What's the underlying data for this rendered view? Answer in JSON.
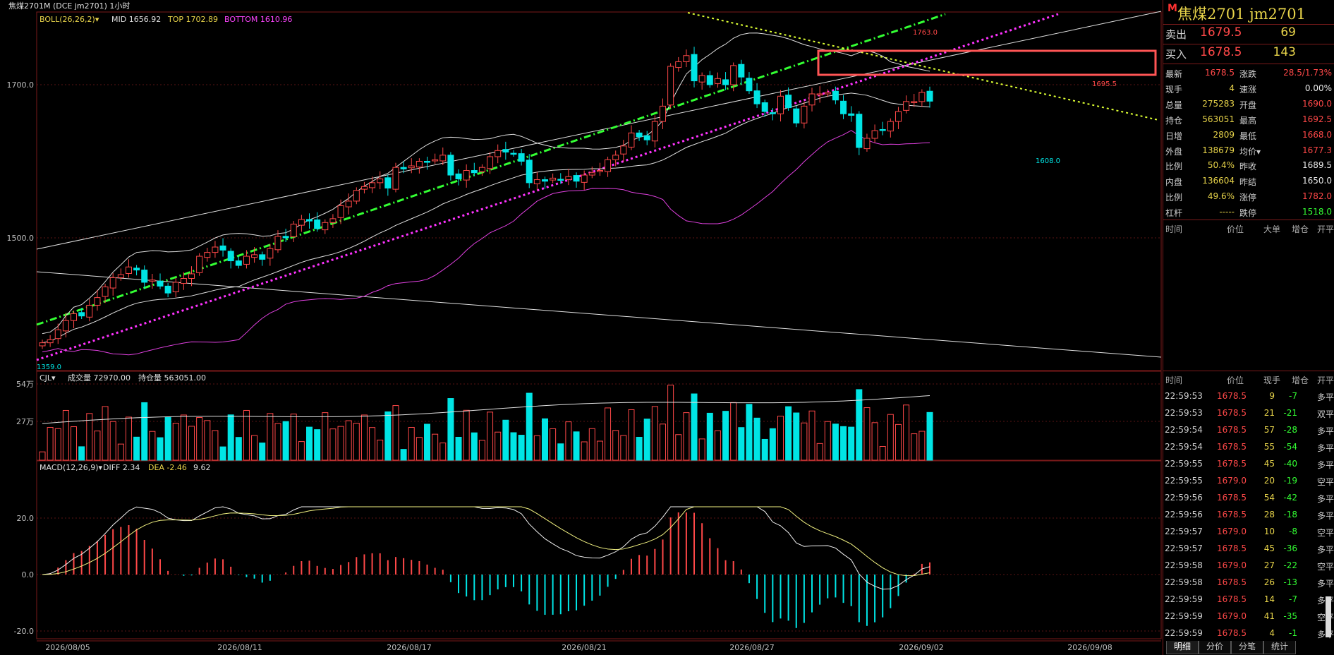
{
  "header": {
    "title": "焦煤2701",
    "title_marker": "M",
    "code": "(DCE jm2701)",
    "period": "1小时",
    "boll_label": "BOLL(26,26,2)",
    "mid_text": "MID 1656.92",
    "top_text": "TOP 1702.89",
    "bottom_text": "BOTTOM 1610.96"
  },
  "annotations": {
    "high": "1763.0",
    "low": "1359.0",
    "peak2": "1695.5",
    "trough": "1608.0"
  },
  "volume_panel": {
    "label": "CJL",
    "volume_text": "成交量 72970.00",
    "oi_text": "持仓量 563051.00",
    "axis_labels": [
      "54万",
      "27万"
    ]
  },
  "macd_panel": {
    "label": "MACD(12,26,9)",
    "diff_text": "DIFF 2.34",
    "dea_text": "DEA -2.46",
    "macd_text": "9.62",
    "axis_labels": [
      "20.0",
      "0.0",
      "-20.0"
    ]
  },
  "chart_data": {
    "type": "candlestick",
    "price_axis_labels": [
      "1700.0",
      "1500.0"
    ],
    "x_labels": [
      "2026/08/05",
      "2026/08/11",
      "2026/08/17",
      "2026/08/21",
      "2026/08/27",
      "2026/09/02",
      "2026/09/08"
    ],
    "closes": [
      1363,
      1367,
      1380,
      1392,
      1401,
      1398,
      1412,
      1422,
      1436,
      1448,
      1452,
      1462,
      1458,
      1442,
      1445,
      1437,
      1428,
      1442,
      1447,
      1453,
      1476,
      1481,
      1488,
      1484,
      1470,
      1464,
      1476,
      1478,
      1472,
      1486,
      1502,
      1500,
      1518,
      1524,
      1522,
      1512,
      1520,
      1525,
      1542,
      1548,
      1562,
      1567,
      1572,
      1577,
      1565,
      1592,
      1590,
      1594,
      1600,
      1599,
      1602,
      1608,
      1582,
      1577,
      1588,
      1585,
      1592,
      1606,
      1614,
      1612,
      1610,
      1600,
      1572,
      1576,
      1574,
      1578,
      1576,
      1580,
      1574,
      1582,
      1585,
      1588,
      1602,
      1608,
      1620,
      1637,
      1632,
      1628,
      1652,
      1672,
      1724,
      1730,
      1738,
      1705,
      1712,
      1700,
      1708,
      1700,
      1725,
      1710,
      1692,
      1675,
      1665,
      1662,
      1685,
      1670,
      1650,
      1672,
      1688,
      1688,
      1690,
      1680,
      1662,
      1660,
      1618,
      1630,
      1640,
      1641,
      1652,
      1665,
      1678,
      1678,
      1690,
      1678.5
    ]
  },
  "quote": {
    "symbol_title": "焦煤2701  jm2701",
    "sell": {
      "label": "卖出",
      "price": "1679.5",
      "volume": "69"
    },
    "buy": {
      "label": "买入",
      "price": "1678.5",
      "volume": "143"
    },
    "fields": [
      {
        "k1": "最新",
        "v1": "1678.5",
        "c1": "#ff4848",
        "k2": "涨跌",
        "v2": "28.5/1.73%",
        "c2": "#ff4848"
      },
      {
        "k1": "现手",
        "v1": "4",
        "c1": "#e8d44a",
        "k2": "速涨",
        "v2": "0.00%",
        "c2": "#e8e8e8"
      },
      {
        "k1": "总量",
        "v1": "275283",
        "c1": "#e8d44a",
        "k2": "开盘",
        "v2": "1690.0",
        "c2": "#ff4848"
      },
      {
        "k1": "持仓",
        "v1": "563051",
        "c1": "#e8d44a",
        "k2": "最高",
        "v2": "1692.5",
        "c2": "#ff4848"
      },
      {
        "k1": "日增",
        "v1": "2809",
        "c1": "#e8d44a",
        "k2": "最低",
        "v2": "1668.0",
        "c2": "#ff4848"
      },
      {
        "k1": "外盘",
        "v1": "138679",
        "c1": "#e8d44a",
        "k2": "均价",
        "v2": "1677.3",
        "c2": "#ff4848"
      },
      {
        "k1": "比例",
        "v1": "50.4%",
        "c1": "#e8d44a",
        "k2": "昨收",
        "v2": "1689.5",
        "c2": "#e8e8e8"
      },
      {
        "k1": "内盘",
        "v1": "136604",
        "c1": "#e8d44a",
        "k2": "昨结",
        "v2": "1650.0",
        "c2": "#e8e8e8"
      },
      {
        "k1": "比例",
        "v1": "49.6%",
        "c1": "#e8d44a",
        "k2": "涨停",
        "v2": "1782.0",
        "c2": "#ff4848"
      },
      {
        "k1": "杠杆",
        "v1": "-----",
        "c1": "#e8d44a",
        "k2": "跌停",
        "v2": "1518.0",
        "c2": "#33ff33"
      }
    ],
    "avg_arrow": "▾",
    "detail_headers": [
      "时间",
      "价位",
      "大单",
      "增仓",
      "开平"
    ],
    "tick_headers": [
      "时间",
      "价位",
      "现手",
      "增仓",
      "开平"
    ],
    "ticks": [
      {
        "time": "22:59:53",
        "price": "1678.5",
        "qty": "9",
        "oi": "-7",
        "type": "多平"
      },
      {
        "time": "22:59:53",
        "price": "1678.5",
        "qty": "21",
        "oi": "-21",
        "type": "双平"
      },
      {
        "time": "22:59:54",
        "price": "1678.5",
        "qty": "57",
        "oi": "-28",
        "type": "多平"
      },
      {
        "time": "22:59:54",
        "price": "1678.5",
        "qty": "55",
        "oi": "-54",
        "type": "多平"
      },
      {
        "time": "22:59:55",
        "price": "1678.5",
        "qty": "45",
        "oi": "-40",
        "type": "多平"
      },
      {
        "time": "22:59:55",
        "price": "1679.0",
        "qty": "20",
        "oi": "-19",
        "type": "空平"
      },
      {
        "time": "22:59:56",
        "price": "1678.5",
        "qty": "54",
        "oi": "-42",
        "type": "多平"
      },
      {
        "time": "22:59:56",
        "price": "1678.5",
        "qty": "28",
        "oi": "-18",
        "type": "多平"
      },
      {
        "time": "22:59:57",
        "price": "1679.0",
        "qty": "10",
        "oi": "-8",
        "type": "空平"
      },
      {
        "time": "22:59:57",
        "price": "1678.5",
        "qty": "45",
        "oi": "-36",
        "type": "多平"
      },
      {
        "time": "22:59:58",
        "price": "1679.0",
        "qty": "27",
        "oi": "-22",
        "type": "空平"
      },
      {
        "time": "22:59:58",
        "price": "1678.5",
        "qty": "26",
        "oi": "-13",
        "type": "多平"
      },
      {
        "time": "22:59:59",
        "price": "1678.5",
        "qty": "14",
        "oi": "-7",
        "type": "多平"
      },
      {
        "time": "22:59:59",
        "price": "1679.0",
        "qty": "41",
        "oi": "-35",
        "type": "空平"
      },
      {
        "time": "22:59:59",
        "price": "1678.5",
        "qty": "4",
        "oi": "-1",
        "type": "多平"
      }
    ],
    "tabs": [
      "明细",
      "分价",
      "分笔",
      "统计"
    ],
    "colors": {
      "up": "#ff4848",
      "down": "#33ff33",
      "yellow": "#e8d44a",
      "cyan": "#00e5e5"
    }
  }
}
